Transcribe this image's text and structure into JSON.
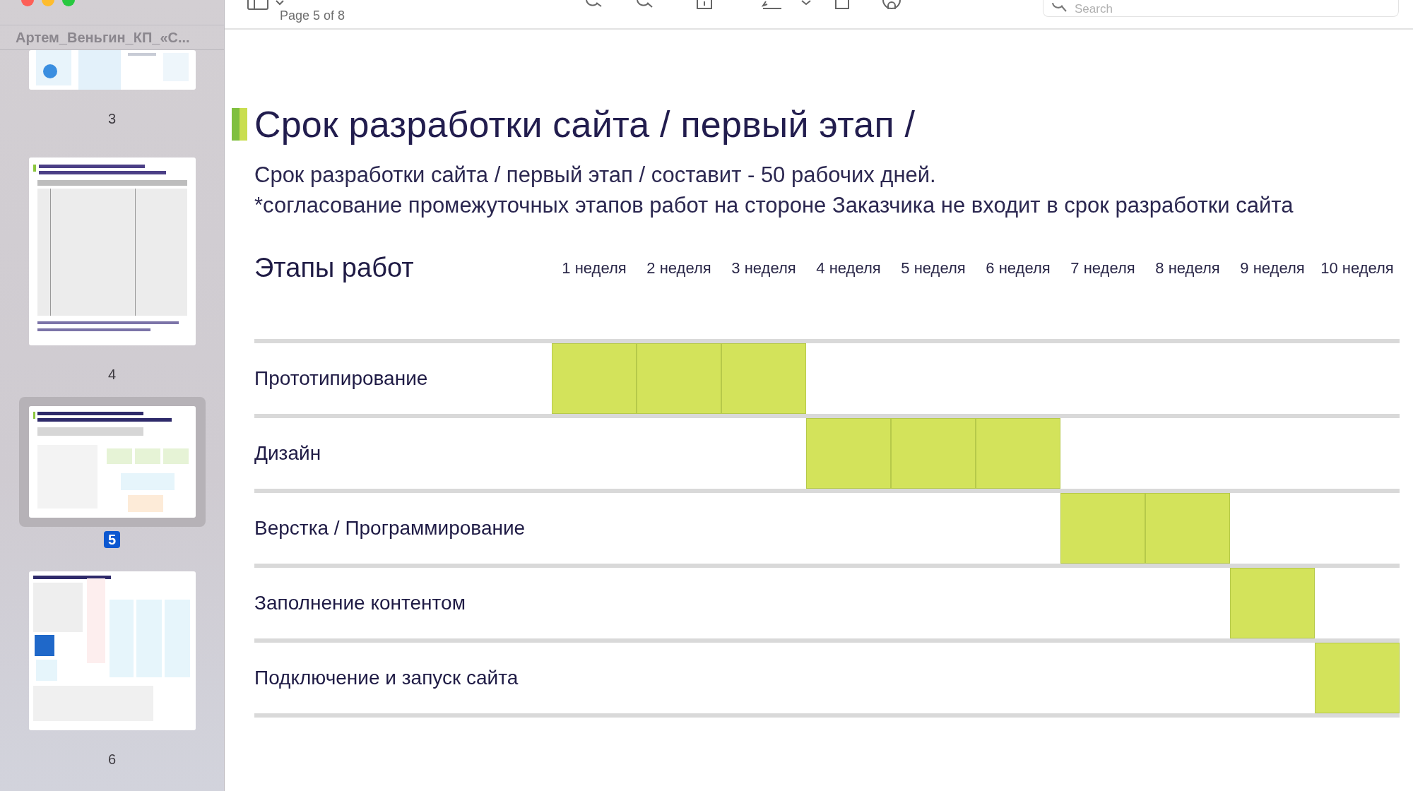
{
  "toolbar": {
    "page_indicator": "Page 5 of 8",
    "search": {
      "placeholder": "Search"
    }
  },
  "sidebar": {
    "title": "Артем_Веньгин_КП_«С...",
    "pages": [
      {
        "label": "3",
        "selected": false
      },
      {
        "label": "4",
        "selected": false
      },
      {
        "label": "5",
        "selected": true
      },
      {
        "label": "6",
        "selected": false
      }
    ]
  },
  "slide": {
    "title": "Срок разработки сайта / первый этап /",
    "lines": [
      "Срок разработки сайта / первый этап / составит - 50 рабочих дней.",
      "*согласование промежуточных этапов работ на стороне Заказчика не входит в срок разработки сайта"
    ],
    "stages_heading": "Этапы работ",
    "weeks": [
      "1 неделя",
      "2 неделя",
      "3 неделя",
      "4 неделя",
      "5 неделя",
      "6 неделя",
      "7 неделя",
      "8 неделя",
      "9 неделя",
      "10 неделя"
    ],
    "stages": [
      {
        "name": "Прототипирование",
        "cells": [
          {
            "kind": "filled"
          },
          {
            "kind": "filled"
          },
          {
            "kind": "filled"
          },
          {
            "kind": "empty"
          },
          {
            "kind": "empty"
          },
          {
            "kind": "empty"
          },
          {
            "kind": "empty"
          },
          {
            "kind": "empty"
          },
          {
            "kind": "empty"
          },
          {
            "kind": "empty"
          }
        ]
      },
      {
        "name": "Дизайн",
        "cells": [
          {
            "kind": "empty"
          },
          {
            "kind": "empty"
          },
          {
            "kind": "empty"
          },
          {
            "kind": "filled"
          },
          {
            "kind": "filled"
          },
          {
            "kind": "filled"
          },
          {
            "kind": "empty"
          },
          {
            "kind": "empty"
          },
          {
            "kind": "empty"
          },
          {
            "kind": "empty"
          }
        ]
      },
      {
        "name": "Верстка / Программирование",
        "cells": [
          {
            "kind": "empty"
          },
          {
            "kind": "empty"
          },
          {
            "kind": "empty"
          },
          {
            "kind": "empty"
          },
          {
            "kind": "empty"
          },
          {
            "kind": "empty"
          },
          {
            "kind": "filled"
          },
          {
            "kind": "filled"
          },
          {
            "kind": "empty"
          },
          {
            "kind": "empty"
          }
        ]
      },
      {
        "name": "Заполнение контентом",
        "cells": [
          {
            "kind": "empty"
          },
          {
            "kind": "empty"
          },
          {
            "kind": "empty"
          },
          {
            "kind": "empty"
          },
          {
            "kind": "empty"
          },
          {
            "kind": "empty"
          },
          {
            "kind": "empty"
          },
          {
            "kind": "empty"
          },
          {
            "kind": "filled"
          },
          {
            "kind": "empty"
          }
        ]
      },
      {
        "name": "Подключение и запуск сайта",
        "cells": [
          {
            "kind": "empty"
          },
          {
            "kind": "empty"
          },
          {
            "kind": "empty"
          },
          {
            "kind": "empty"
          },
          {
            "kind": "empty"
          },
          {
            "kind": "empty"
          },
          {
            "kind": "empty"
          },
          {
            "kind": "empty"
          },
          {
            "kind": "empty"
          },
          {
            "kind": "filled"
          }
        ]
      }
    ]
  }
}
